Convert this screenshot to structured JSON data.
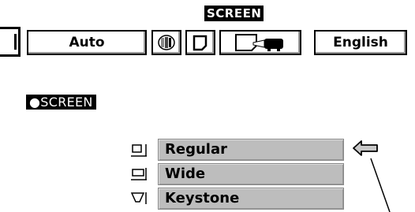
{
  "menu": {
    "title": "SCREEN",
    "auto_label": "Auto",
    "language_label": "English",
    "icons": [
      "side-tab-icon",
      "color-balance-icon",
      "screen-icon",
      "screen-projector-icon"
    ]
  },
  "section": {
    "label": "●SCREEN"
  },
  "options": [
    {
      "label": "Regular",
      "icon": "regular-screen-icon",
      "selected": true
    },
    {
      "label": "Wide",
      "icon": "wide-screen-icon",
      "selected": false
    },
    {
      "label": "Keystone",
      "icon": "keystone-icon",
      "selected": false
    }
  ],
  "pointer": {
    "icon": "left-arrow-icon"
  }
}
